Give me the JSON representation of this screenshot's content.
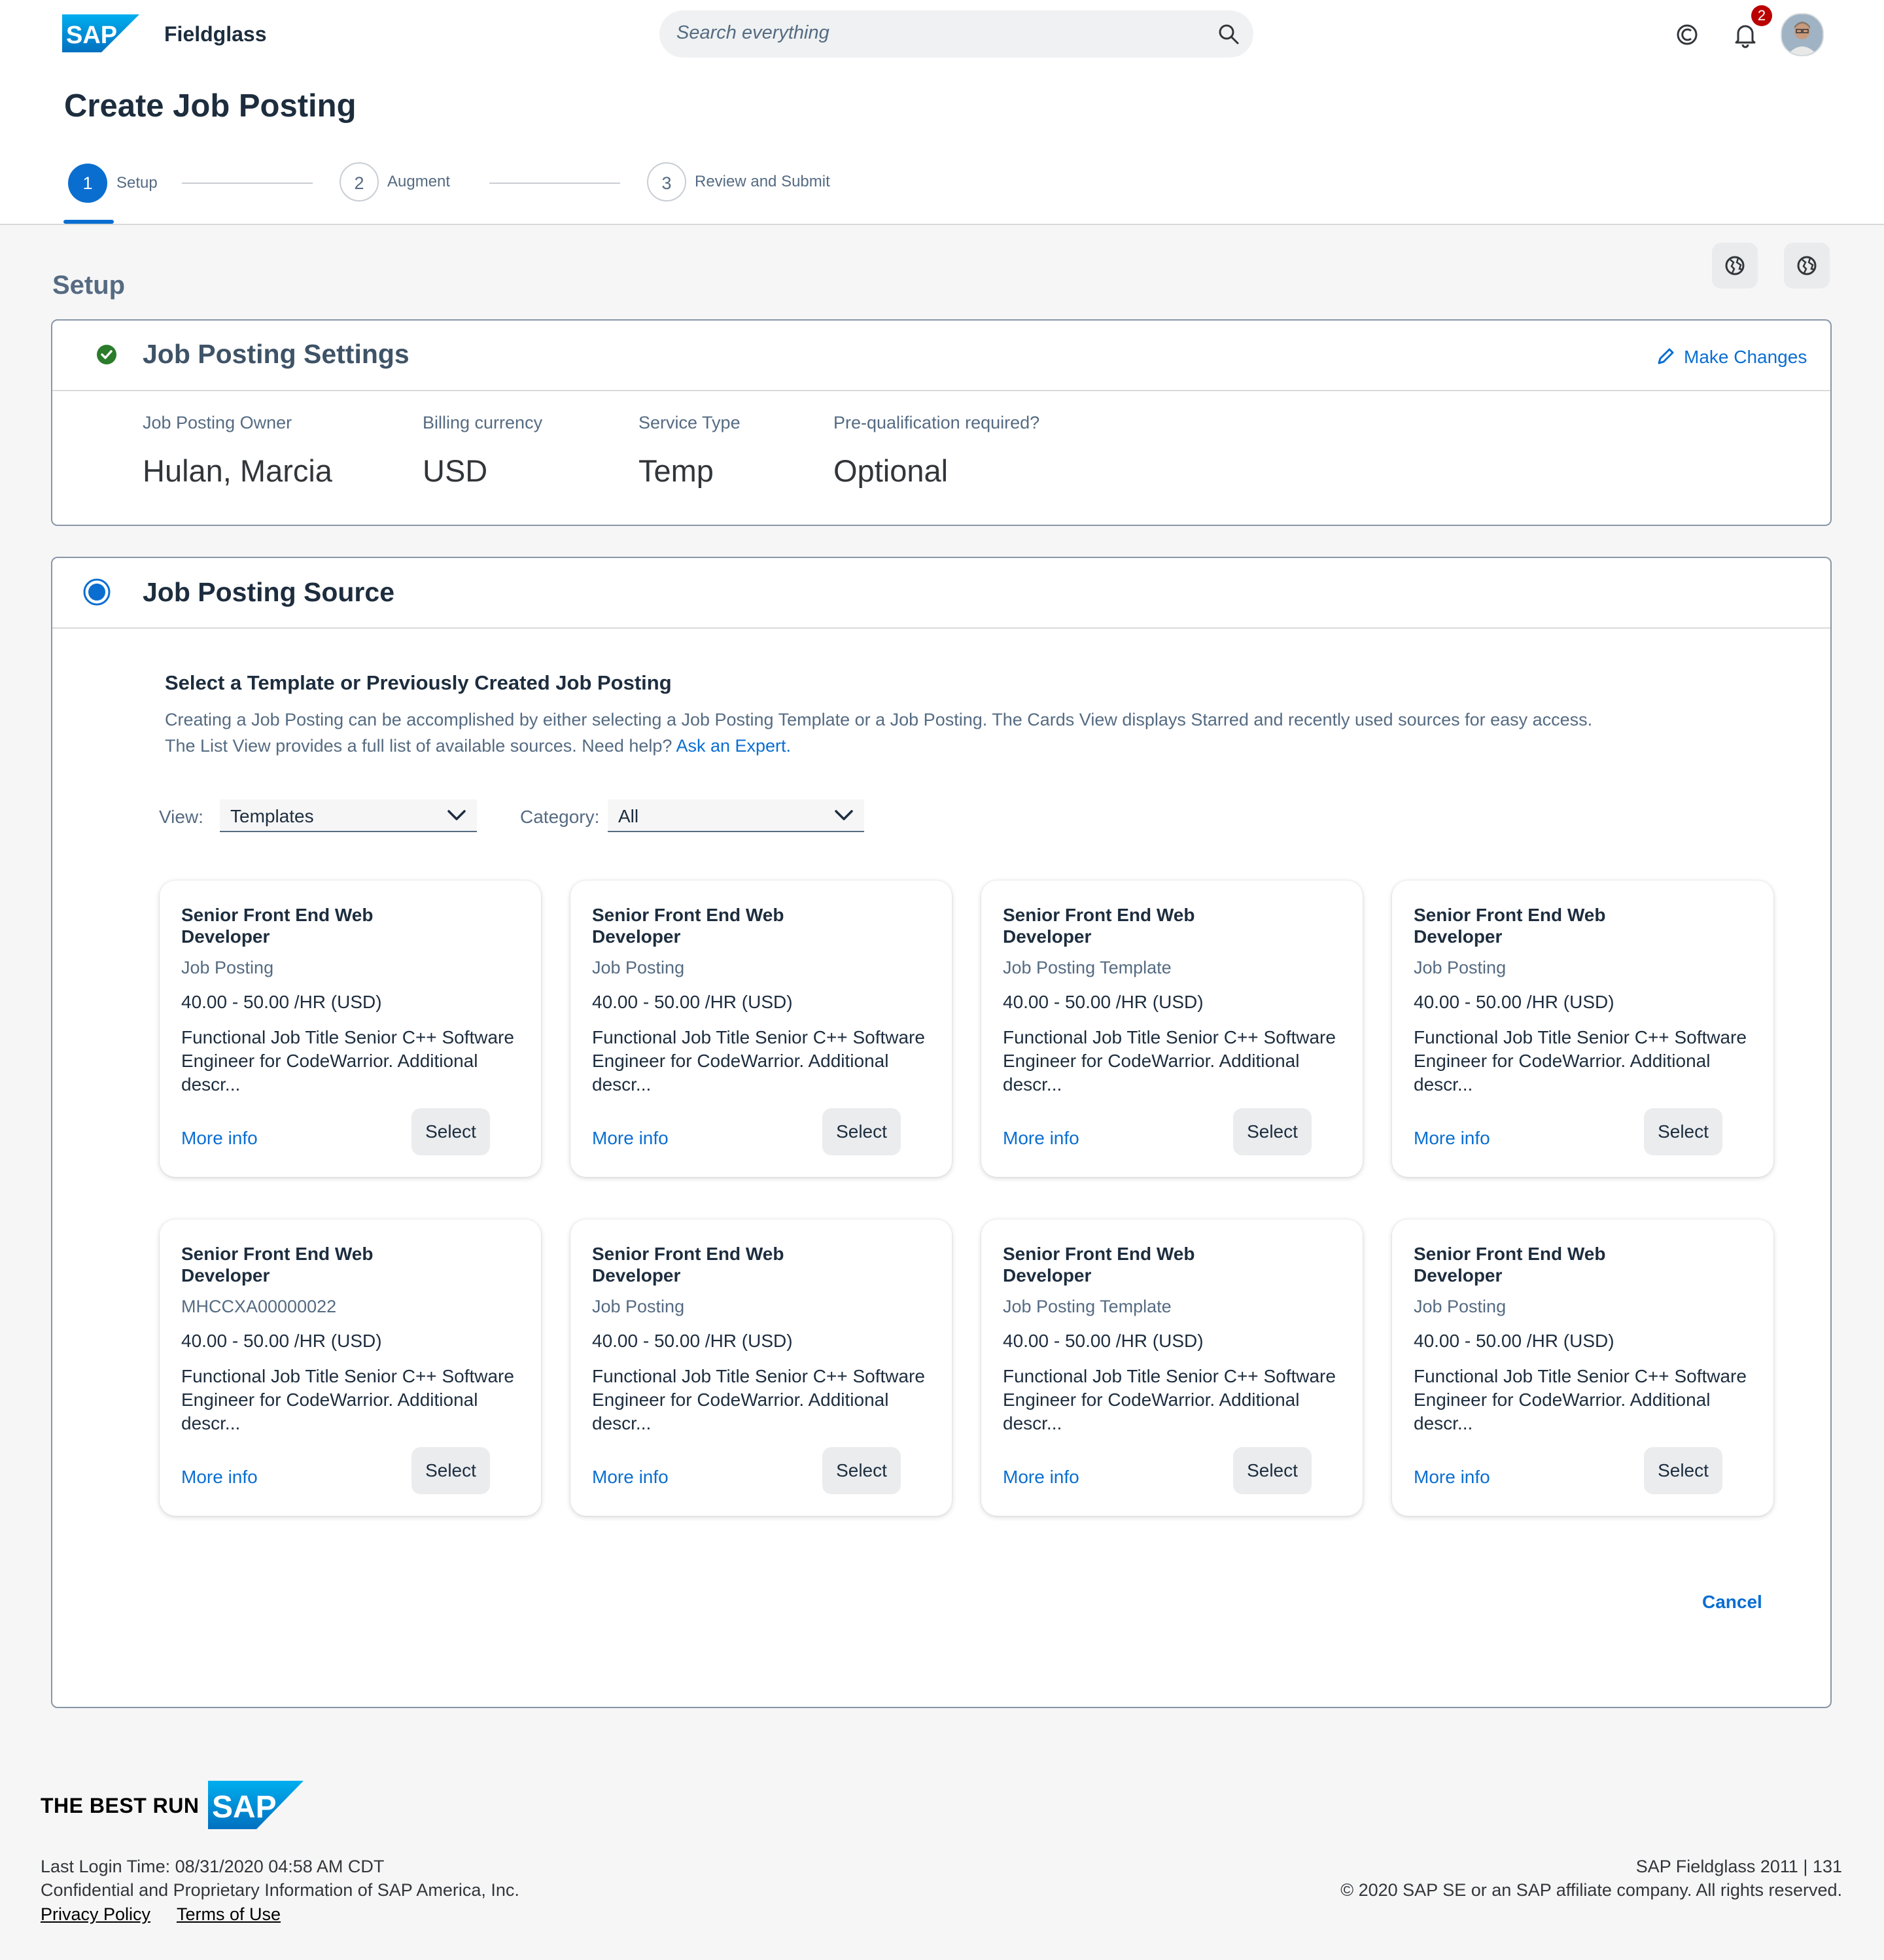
{
  "header": {
    "logo_text": "SAP",
    "app_name": "Fieldglass",
    "search_placeholder": "Search everything",
    "notification_count": "2",
    "icons": [
      "search-icon",
      "copilot-icon",
      "bell-icon",
      "avatar"
    ]
  },
  "page": {
    "title": "Create Job Posting",
    "steps": [
      {
        "number": "1",
        "label": "Setup",
        "active": true
      },
      {
        "number": "2",
        "label": "Augment",
        "active": false
      },
      {
        "number": "3",
        "label": "Review and Submit",
        "active": false
      }
    ]
  },
  "setup": {
    "title": "Setup",
    "tool_icons": [
      "globe-icon",
      "globe-icon"
    ]
  },
  "settings_panel": {
    "title": "Job Posting Settings",
    "make_changes": "Make Changes",
    "fields": [
      {
        "label": "Job Posting Owner",
        "value": "Hulan, Marcia"
      },
      {
        "label": "Billing currency",
        "value": "USD"
      },
      {
        "label": "Service Type",
        "value": "Temp"
      },
      {
        "label": "Pre-qualification required?",
        "value": "Optional"
      }
    ]
  },
  "source_panel": {
    "title": "Job Posting Source",
    "heading": "Select a Template or Previously Created Job Posting",
    "description": "Creating a Job Posting can be accomplished by either selecting a Job Posting Template or a Job Posting. The Cards View displays Starred and recently used sources for easy access. The List View provides a full list of available sources. Need help?",
    "help_link": "Ask an Expert.",
    "view_label": "View:",
    "view_value": "Templates",
    "category_label": "Category:",
    "category_value": "All",
    "cards": [
      {
        "title": "Senior Front End Web Developer",
        "subtitle": "Job Posting",
        "rate": "40.00 - 50.00 /HR (USD)",
        "description": "Functional Job Title Senior C++ Software Engineer for CodeWarrior. Additional descr...",
        "more": "More info",
        "select": "Select"
      },
      {
        "title": "Senior Front End Web Developer",
        "subtitle": "Job Posting",
        "rate": "40.00 - 50.00 /HR (USD)",
        "description": "Functional Job Title Senior C++ Software Engineer for CodeWarrior. Additional descr...",
        "more": "More info",
        "select": "Select"
      },
      {
        "title": "Senior Front End Web Developer",
        "subtitle": "Job Posting Template",
        "rate": "40.00 - 50.00 /HR (USD)",
        "description": "Functional Job Title Senior C++ Software Engineer for CodeWarrior. Additional descr...",
        "more": "More info",
        "select": "Select"
      },
      {
        "title": "Senior Front End Web Developer",
        "subtitle": "Job Posting",
        "rate": "40.00 - 50.00 /HR (USD)",
        "description": "Functional Job Title Senior C++ Software Engineer for CodeWarrior. Additional descr...",
        "more": "More info",
        "select": "Select"
      },
      {
        "title": "Senior Front End Web Developer",
        "subtitle": "MHCCXA00000022",
        "rate": "40.00 - 50.00 /HR (USD)",
        "description": "Functional Job Title Senior C++ Software Engineer for CodeWarrior. Additional descr...",
        "more": "More info",
        "select": "Select"
      },
      {
        "title": "Senior Front End Web Developer",
        "subtitle": "Job Posting",
        "rate": "40.00 - 50.00 /HR (USD)",
        "description": "Functional Job Title Senior C++ Software Engineer for CodeWarrior. Additional descr...",
        "more": "More info",
        "select": "Select"
      },
      {
        "title": "Senior Front End Web Developer",
        "subtitle": "Job Posting Template",
        "rate": "40.00 - 50.00 /HR (USD)",
        "description": "Functional Job Title Senior C++ Software Engineer for CodeWarrior. Additional descr...",
        "more": "More info",
        "select": "Select"
      },
      {
        "title": "Senior Front End Web Developer",
        "subtitle": "Job Posting",
        "rate": "40.00 - 50.00 /HR (USD)",
        "description": "Functional Job Title Senior C++ Software Engineer for CodeWarrior. Additional descr...",
        "more": "More info",
        "select": "Select"
      }
    ],
    "cancel": "Cancel"
  },
  "footer": {
    "tagline": "THE BEST RUN",
    "logo_text": "SAP",
    "last_login": "Last Login Time: 08/31/2020 04:58 AM CDT",
    "confidential": "Confidential and Proprietary Information of SAP America, Inc.",
    "privacy": "Privacy Policy",
    "terms": "Terms of Use",
    "version": "SAP Fieldglass 2011 | 131",
    "copyright": "© 2020 SAP SE or an SAP affiliate company. All rights reserved."
  },
  "colors": {
    "accent": "#0a6ed1",
    "success": "#2b7c2b",
    "badge": "#bb0000"
  }
}
